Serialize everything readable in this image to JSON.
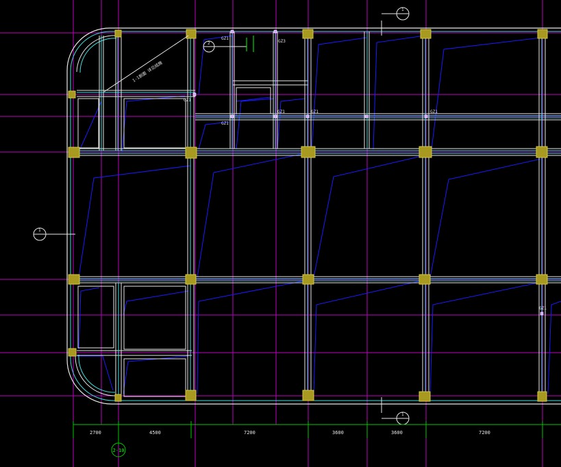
{
  "colors": {
    "background": "#000000",
    "grid_line": "#c000c0",
    "wall_white": "#e8e8e8",
    "wall_cyan": "#40e0e0",
    "slab_blue": "#1a1aff",
    "column_fill": "#a89a20",
    "column_edge": "#d6c840",
    "dim_green": "#00c800",
    "text": "#e6e6e6"
  },
  "dimensions": [
    "2700",
    "4500",
    "7200",
    "3600",
    "3600",
    "7200"
  ],
  "axis_label": "2-10",
  "column_tags": {
    "gz1_a": "GZ1",
    "gz1_b": "GZ1",
    "gz1_c": "GZ1",
    "gz1_d": "GZ1",
    "gz1_e": "GZ1",
    "gz1_f": "GZ1",
    "gz3": "GZ3",
    "gz1_right": "GZ1"
  },
  "section_markers": {
    "top": "1",
    "left": "1",
    "bottom": "1",
    "detail": "2"
  },
  "diagonal_note": "1-1剖面  详见结施"
}
